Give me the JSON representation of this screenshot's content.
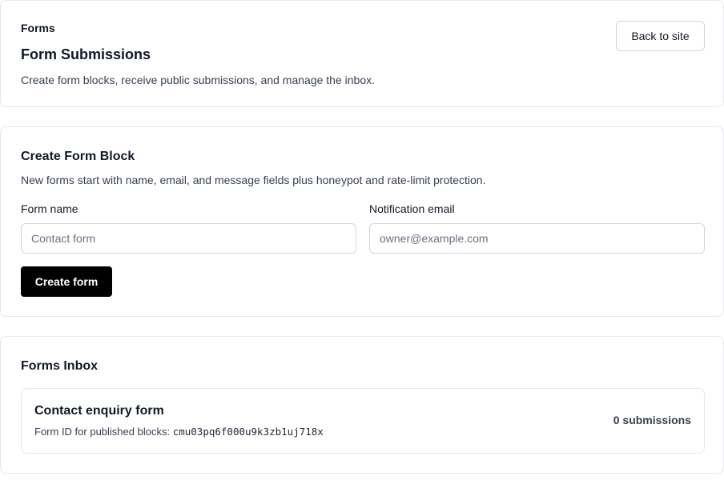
{
  "header": {
    "eyebrow": "Forms",
    "title": "Form Submissions",
    "description": "Create form blocks, receive public submissions, and manage the inbox.",
    "back_label": "Back to site"
  },
  "create": {
    "title": "Create Form Block",
    "description": "New forms start with name, email, and message fields plus honeypot and rate-limit protection.",
    "name_label": "Form name",
    "name_placeholder": "Contact form",
    "email_label": "Notification email",
    "email_placeholder": "owner@example.com",
    "submit_label": "Create form"
  },
  "inbox": {
    "title": "Forms Inbox",
    "forms": [
      {
        "name": "Contact enquiry form",
        "id_label": "Form ID for published blocks: ",
        "id": "cmu03pq6f000u9k3zb1uj718x",
        "count": "0 submissions"
      }
    ]
  },
  "colors": {
    "primary_button": "#000000",
    "border": "#e5e7eb",
    "text": "#111827",
    "muted_text": "#374151"
  }
}
